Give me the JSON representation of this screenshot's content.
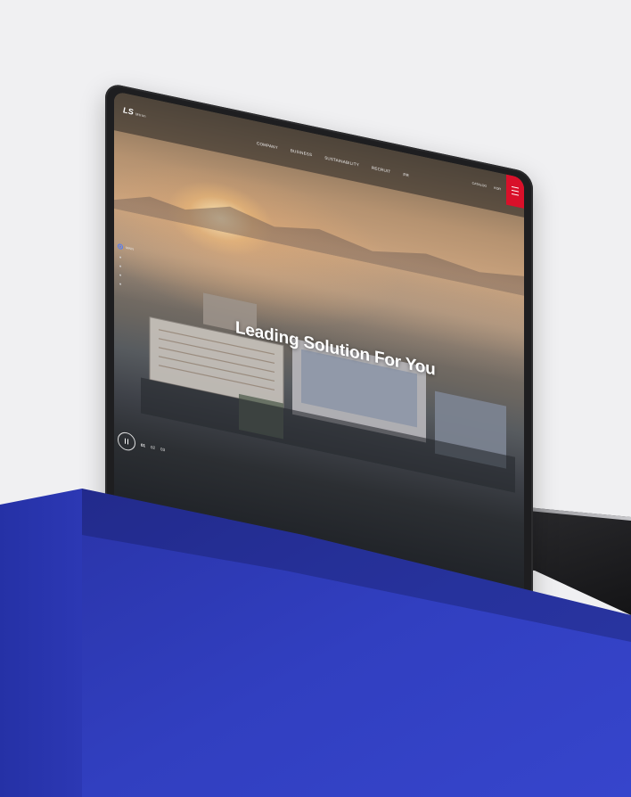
{
  "site": {
    "logo": "LS",
    "logo_sub": "Mtron",
    "nav": [
      "COMPANY",
      "BUSINESS",
      "SUSTAINABILITY",
      "RECRUIT",
      "PR"
    ],
    "util": [
      "CATALOG",
      "KOR"
    ],
    "hero_title": "Leading Solution For You",
    "side_label": "MAIN",
    "slides": [
      "01",
      "02",
      "03"
    ]
  },
  "colors": {
    "background": "#f0f0f2",
    "accent_blue": "#3443c8",
    "menu_red": "#d9102a",
    "indicator_blue": "#4a78ff"
  },
  "icons": {
    "menu": "hamburger-menu-icon",
    "pause": "pause-icon"
  }
}
